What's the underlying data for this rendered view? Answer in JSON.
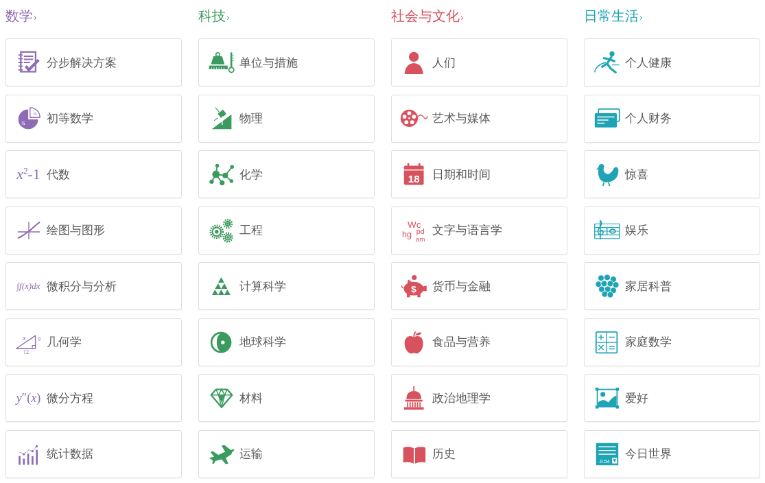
{
  "categories": [
    {
      "title": "数学",
      "chevron": "›",
      "color": "#8f6bb5",
      "items": [
        {
          "label": "分步解决方案"
        },
        {
          "label": "初等数学",
          "icon_text": [
            "¼",
            "¾"
          ]
        },
        {
          "label": "代数",
          "formula": "*x*$^{2}$-1"
        },
        {
          "label": "绘图与图形"
        },
        {
          "label": "微积分与分析",
          "formula": "∫f(x)dx"
        },
        {
          "label": "几何学",
          "icon_text": [
            "x",
            "9",
            "12"
          ]
        },
        {
          "label": "微分方程",
          "formula": "*y*″(*x*)"
        },
        {
          "label": "统计数据"
        }
      ]
    },
    {
      "title": "科技",
      "chevron": "›",
      "color": "#3b9a5d",
      "items": [
        {
          "label": "单位与措施"
        },
        {
          "label": "物理"
        },
        {
          "label": "化学"
        },
        {
          "label": "工程"
        },
        {
          "label": "计算科学"
        },
        {
          "label": "地球科学"
        },
        {
          "label": "材料"
        },
        {
          "label": "运输"
        }
      ]
    },
    {
      "title": "社会与文化",
      "chevron": "›",
      "color": "#d8525e",
      "items": [
        {
          "label": "人们"
        },
        {
          "label": "艺术与媒体"
        },
        {
          "label": "日期和时间",
          "icon_text": [
            "18"
          ]
        },
        {
          "label": "文字与语言学",
          "icon_text": [
            "Wc",
            "hg",
            "pd",
            "am"
          ]
        },
        {
          "label": "货币与金融",
          "icon_text": [
            "$"
          ]
        },
        {
          "label": "食品与营养"
        },
        {
          "label": "政治地理学"
        },
        {
          "label": "历史"
        }
      ]
    },
    {
      "title": "日常生活",
      "chevron": "›",
      "color": "#1ea4b4",
      "items": [
        {
          "label": "个人健康"
        },
        {
          "label": "个人财务"
        },
        {
          "label": "惊喜"
        },
        {
          "label": "娱乐"
        },
        {
          "label": "家居科普"
        },
        {
          "label": "家庭数学"
        },
        {
          "label": "爱好"
        },
        {
          "label": "今日世界",
          "icon_text": [
            "-0.54"
          ]
        }
      ]
    }
  ]
}
